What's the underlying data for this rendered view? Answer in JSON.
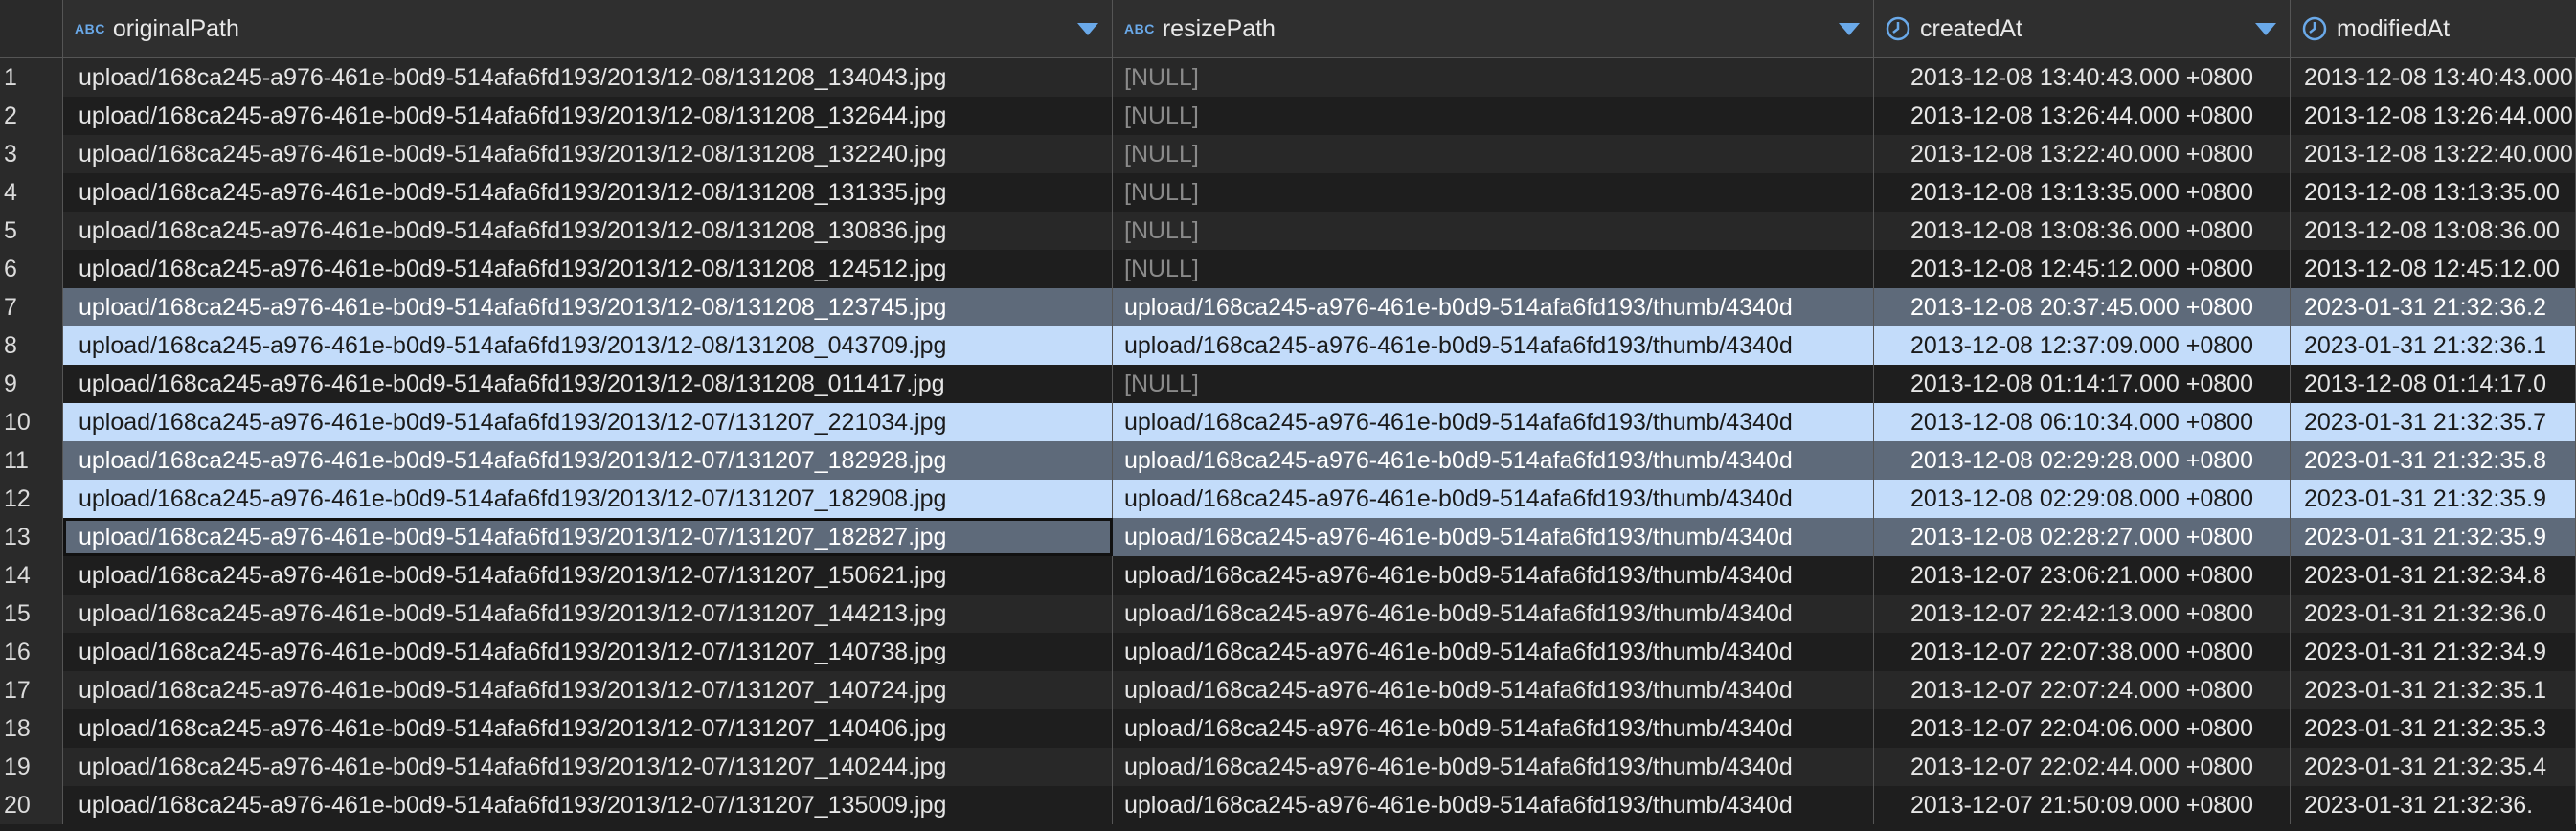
{
  "columns": [
    {
      "name": "originalPath",
      "type_icon": "ABC",
      "icon": "text-type-icon"
    },
    {
      "name": "resizePath",
      "type_icon": "ABC",
      "icon": "text-type-icon"
    },
    {
      "name": "createdAt",
      "type_icon": "clock",
      "icon": "datetime-type-icon"
    },
    {
      "name": "modifiedAt",
      "type_icon": "clock",
      "icon": "datetime-type-icon"
    }
  ],
  "rows": [
    {
      "n": "1",
      "originalPath": "upload/168ca245-a976-461e-b0d9-514afa6fd193/2013/12-08/131208_134043.jpg",
      "resizePath": "[NULL]",
      "createdAt": "2013-12-08 13:40:43.000 +0800",
      "modifiedAt": "2013-12-08 13:40:43.000",
      "style": "odd"
    },
    {
      "n": "2",
      "originalPath": "upload/168ca245-a976-461e-b0d9-514afa6fd193/2013/12-08/131208_132644.jpg",
      "resizePath": "[NULL]",
      "createdAt": "2013-12-08 13:26:44.000 +0800",
      "modifiedAt": "2013-12-08 13:26:44.000",
      "style": "even"
    },
    {
      "n": "3",
      "originalPath": "upload/168ca245-a976-461e-b0d9-514afa6fd193/2013/12-08/131208_132240.jpg",
      "resizePath": "[NULL]",
      "createdAt": "2013-12-08 13:22:40.000 +0800",
      "modifiedAt": "2013-12-08 13:22:40.000",
      "style": "odd"
    },
    {
      "n": "4",
      "originalPath": "upload/168ca245-a976-461e-b0d9-514afa6fd193/2013/12-08/131208_131335.jpg",
      "resizePath": "[NULL]",
      "createdAt": "2013-12-08 13:13:35.000 +0800",
      "modifiedAt": "2013-12-08 13:13:35.00",
      "style": "even"
    },
    {
      "n": "5",
      "originalPath": "upload/168ca245-a976-461e-b0d9-514afa6fd193/2013/12-08/131208_130836.jpg",
      "resizePath": "[NULL]",
      "createdAt": "2013-12-08 13:08:36.000 +0800",
      "modifiedAt": "2013-12-08 13:08:36.00",
      "style": "odd"
    },
    {
      "n": "6",
      "originalPath": "upload/168ca245-a976-461e-b0d9-514afa6fd193/2013/12-08/131208_124512.jpg",
      "resizePath": "[NULL]",
      "createdAt": "2013-12-08 12:45:12.000 +0800",
      "modifiedAt": "2013-12-08 12:45:12.00",
      "style": "even"
    },
    {
      "n": "7",
      "originalPath": "upload/168ca245-a976-461e-b0d9-514afa6fd193/2013/12-08/131208_123745.jpg",
      "resizePath": "upload/168ca245-a976-461e-b0d9-514afa6fd193/thumb/4340d",
      "createdAt": "2013-12-08 20:37:45.000 +0800",
      "modifiedAt": "2023-01-31 21:32:36.2",
      "style": "sel-gray"
    },
    {
      "n": "8",
      "originalPath": "upload/168ca245-a976-461e-b0d9-514afa6fd193/2013/12-08/131208_043709.jpg",
      "resizePath": "upload/168ca245-a976-461e-b0d9-514afa6fd193/thumb/4340d",
      "createdAt": "2013-12-08 12:37:09.000 +0800",
      "modifiedAt": "2023-01-31 21:32:36.1",
      "style": "sel-blue"
    },
    {
      "n": "9",
      "originalPath": "upload/168ca245-a976-461e-b0d9-514afa6fd193/2013/12-08/131208_011417.jpg",
      "resizePath": "[NULL]",
      "createdAt": "2013-12-08 01:14:17.000 +0800",
      "modifiedAt": "2013-12-08 01:14:17.0",
      "style": "even"
    },
    {
      "n": "10",
      "originalPath": "upload/168ca245-a976-461e-b0d9-514afa6fd193/2013/12-07/131207_221034.jpg",
      "resizePath": "upload/168ca245-a976-461e-b0d9-514afa6fd193/thumb/4340d",
      "createdAt": "2013-12-08 06:10:34.000 +0800",
      "modifiedAt": "2023-01-31 21:32:35.7",
      "style": "sel-blue"
    },
    {
      "n": "11",
      "originalPath": "upload/168ca245-a976-461e-b0d9-514afa6fd193/2013/12-07/131207_182928.jpg",
      "resizePath": "upload/168ca245-a976-461e-b0d9-514afa6fd193/thumb/4340d",
      "createdAt": "2013-12-08 02:29:28.000 +0800",
      "modifiedAt": "2023-01-31 21:32:35.8",
      "style": "sel-gray"
    },
    {
      "n": "12",
      "originalPath": "upload/168ca245-a976-461e-b0d9-514afa6fd193/2013/12-07/131207_182908.jpg",
      "resizePath": "upload/168ca245-a976-461e-b0d9-514afa6fd193/thumb/4340d",
      "createdAt": "2013-12-08 02:29:08.000 +0800",
      "modifiedAt": "2023-01-31 21:32:35.9",
      "style": "sel-blue"
    },
    {
      "n": "13",
      "originalPath": "upload/168ca245-a976-461e-b0d9-514afa6fd193/2013/12-07/131207_182827.jpg",
      "resizePath": "upload/168ca245-a976-461e-b0d9-514afa6fd193/thumb/4340d",
      "createdAt": "2013-12-08 02:28:27.000 +0800",
      "modifiedAt": "2023-01-31 21:32:35.9",
      "style": "sel-gray",
      "focused": true
    },
    {
      "n": "14",
      "originalPath": "upload/168ca245-a976-461e-b0d9-514afa6fd193/2013/12-07/131207_150621.jpg",
      "resizePath": "upload/168ca245-a976-461e-b0d9-514afa6fd193/thumb/4340d",
      "createdAt": "2013-12-07 23:06:21.000 +0800",
      "modifiedAt": "2023-01-31 21:32:34.8",
      "style": "even"
    },
    {
      "n": "15",
      "originalPath": "upload/168ca245-a976-461e-b0d9-514afa6fd193/2013/12-07/131207_144213.jpg",
      "resizePath": "upload/168ca245-a976-461e-b0d9-514afa6fd193/thumb/4340d",
      "createdAt": "2013-12-07 22:42:13.000 +0800",
      "modifiedAt": "2023-01-31 21:32:36.0",
      "style": "odd"
    },
    {
      "n": "16",
      "originalPath": "upload/168ca245-a976-461e-b0d9-514afa6fd193/2013/12-07/131207_140738.jpg",
      "resizePath": "upload/168ca245-a976-461e-b0d9-514afa6fd193/thumb/4340d",
      "createdAt": "2013-12-07 22:07:38.000 +0800",
      "modifiedAt": "2023-01-31 21:32:34.9",
      "style": "even"
    },
    {
      "n": "17",
      "originalPath": "upload/168ca245-a976-461e-b0d9-514afa6fd193/2013/12-07/131207_140724.jpg",
      "resizePath": "upload/168ca245-a976-461e-b0d9-514afa6fd193/thumb/4340d",
      "createdAt": "2013-12-07 22:07:24.000 +0800",
      "modifiedAt": "2023-01-31 21:32:35.1",
      "style": "odd"
    },
    {
      "n": "18",
      "originalPath": "upload/168ca245-a976-461e-b0d9-514afa6fd193/2013/12-07/131207_140406.jpg",
      "resizePath": "upload/168ca245-a976-461e-b0d9-514afa6fd193/thumb/4340d",
      "createdAt": "2013-12-07 22:04:06.000 +0800",
      "modifiedAt": "2023-01-31 21:32:35.3",
      "style": "even"
    },
    {
      "n": "19",
      "originalPath": "upload/168ca245-a976-461e-b0d9-514afa6fd193/2013/12-07/131207_140244.jpg",
      "resizePath": "upload/168ca245-a976-461e-b0d9-514afa6fd193/thumb/4340d",
      "createdAt": "2013-12-07 22:02:44.000 +0800",
      "modifiedAt": "2023-01-31 21:32:35.4",
      "style": "odd"
    },
    {
      "n": "20",
      "originalPath": "upload/168ca245-a976-461e-b0d9-514afa6fd193/2013/12-07/131207_135009.jpg",
      "resizePath": "upload/168ca245-a976-461e-b0d9-514afa6fd193/thumb/4340d",
      "createdAt": "2013-12-07 21:50:09.000 +0800",
      "modifiedAt": "2023-01-31 21:32:36.",
      "style": "even"
    }
  ]
}
